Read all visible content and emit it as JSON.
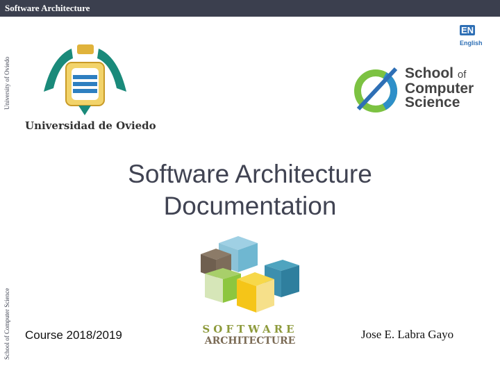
{
  "header": {
    "title": "Software Architecture"
  },
  "side": {
    "university": "University of Oviedo",
    "school": "School of Computer Science"
  },
  "university": {
    "name": "Universidad de Oviedo"
  },
  "language": {
    "code": "EN",
    "name": "English"
  },
  "school_logo": {
    "line1": "School",
    "line1_suffix": "of",
    "line2": "Computer",
    "line3": "Science"
  },
  "slide": {
    "title_line1": "Software Architecture",
    "title_line2": "Documentation"
  },
  "course_logo": {
    "line1": "SOFTWARE",
    "line2": "ARCHITECTURE"
  },
  "footer": {
    "course": "Course 2018/2019",
    "author": "Jose E. Labra Gayo"
  },
  "colors": {
    "bar": "#3b3f4e",
    "title": "#404352",
    "accent_teal": "#1a8a7a",
    "accent_blue": "#2e6fb5"
  }
}
